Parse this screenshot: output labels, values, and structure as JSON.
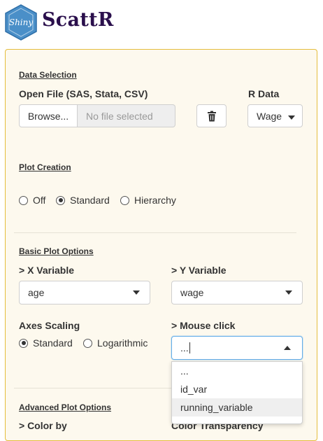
{
  "header": {
    "logo_text": "Shiny",
    "app_title": "ScattR"
  },
  "data_selection": {
    "section_title": "Data Selection",
    "open_file_label": "Open File (SAS, Stata, CSV)",
    "browse_label": "Browse...",
    "file_placeholder": "No file selected",
    "r_data_label": "R Data",
    "r_data_value": "Wage"
  },
  "plot_creation": {
    "section_title": "Plot Creation",
    "options": [
      {
        "label": "Off",
        "selected": false
      },
      {
        "label": "Standard",
        "selected": true
      },
      {
        "label": "Hierarchy",
        "selected": false
      }
    ]
  },
  "basic_plot_options": {
    "section_title": "Basic Plot Options",
    "x_variable_label": "> X Variable",
    "x_variable_value": "age",
    "y_variable_label": "> Y Variable",
    "y_variable_value": "wage",
    "axes_scaling_label": "Axes Scaling",
    "axes_options": [
      {
        "label": "Standard",
        "selected": true
      },
      {
        "label": "Logarithmic",
        "selected": false
      }
    ],
    "mouse_click_label": "> Mouse click",
    "mouse_click_value": "...",
    "mouse_click_options": [
      "...",
      "id_var",
      "running_variable"
    ]
  },
  "advanced_plot_options": {
    "section_title": "Advanced Plot Options",
    "color_by_label": "> Color by",
    "color_transparency_label": "Color Transparency"
  },
  "colors": {
    "accent_border": "#e5bd3c",
    "panel_bg": "#fdf9ee",
    "title": "#2a0f4c",
    "logo": "#4a8fc8"
  }
}
